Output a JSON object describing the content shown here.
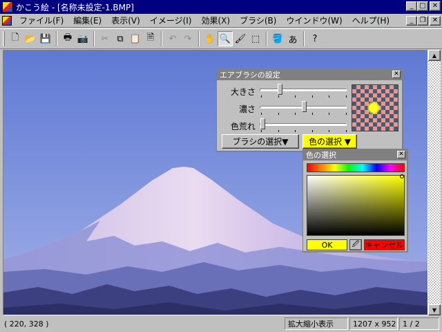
{
  "window": {
    "title": "かこう絵 - [名称未設定-1.BMP]",
    "controls": {
      "minimize": "_",
      "maximize": "□",
      "close": "✕"
    }
  },
  "menubar": {
    "items": [
      {
        "label": "ファイル(F)"
      },
      {
        "label": "編集(E)"
      },
      {
        "label": "表示(V)"
      },
      {
        "label": "イメージ(I)"
      },
      {
        "label": "効果(X)"
      },
      {
        "label": "ブラシ(B)"
      },
      {
        "label": "ウインドウ(W)"
      },
      {
        "label": "ヘルプ(H)"
      }
    ],
    "mdi_controls": {
      "minimize": "_",
      "restore": "❐",
      "close": "✕"
    }
  },
  "toolbar": {
    "buttons": [
      {
        "icon": "new-icon",
        "glyph": "🗋"
      },
      {
        "icon": "open-icon",
        "glyph": "📂"
      },
      {
        "icon": "save-icon",
        "glyph": "💾"
      },
      {
        "icon": "print-icon",
        "glyph": "🖶"
      },
      {
        "icon": "camera-icon",
        "glyph": "📷"
      },
      {
        "icon": "cut-icon",
        "glyph": "✂"
      },
      {
        "icon": "copy-icon",
        "glyph": "⧉"
      },
      {
        "icon": "paste-icon",
        "glyph": "📋"
      },
      {
        "icon": "paste-new-icon",
        "glyph": "🗎"
      },
      {
        "icon": "undo-icon",
        "glyph": "↶"
      },
      {
        "icon": "redo-icon",
        "glyph": "↷"
      },
      {
        "icon": "hand-icon",
        "glyph": "✋"
      },
      {
        "icon": "zoom-icon",
        "glyph": "🔍"
      },
      {
        "icon": "brush-icon",
        "glyph": "🖌"
      },
      {
        "icon": "select-icon",
        "glyph": "⬚"
      },
      {
        "icon": "bucket-icon",
        "glyph": "🪣"
      },
      {
        "icon": "text-icon",
        "glyph": "あ"
      },
      {
        "icon": "help-icon",
        "glyph": "?"
      }
    ]
  },
  "statusbar": {
    "coordinates": "( 220, 328 )",
    "mode": "拡大縮小表示",
    "image_size": "1207 x 952",
    "zoom": "1 / 2"
  },
  "airbrush_panel": {
    "title": "エアブラシの設定",
    "sliders": [
      {
        "label": "大きさ",
        "value": 0.22
      },
      {
        "label": "濃さ",
        "value": 0.5
      },
      {
        "label": "色荒れ",
        "value": 0.02
      }
    ],
    "brush_select_label": "ブラシの選択▼",
    "color_select_label": "色の選択 ▼",
    "color_select_bg": "#ffff00"
  },
  "color_picker": {
    "title": "色の選択",
    "ok_label": "OK",
    "cancel_label": "キャンセル",
    "selected_color": "#ffff00",
    "cancel_color": "#ff0000"
  },
  "colors": {
    "titlebar": "#000080",
    "sky": "#6f86d8",
    "mountain_snow": "#e6d6ee",
    "mountain_shadow": "#a7a2de"
  }
}
